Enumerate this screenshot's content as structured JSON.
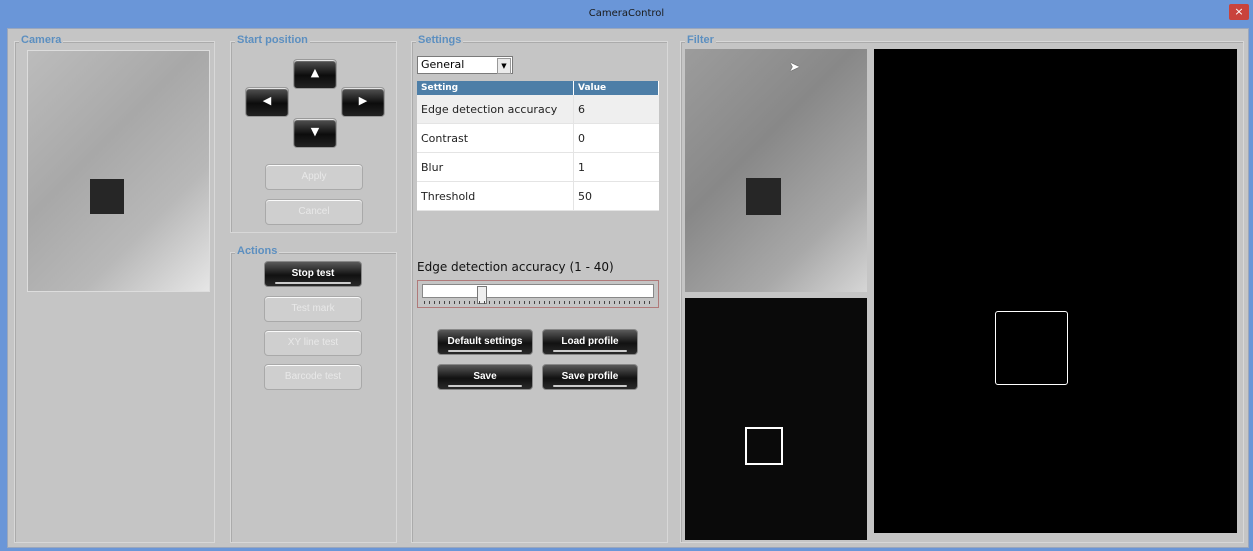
{
  "window": {
    "title": "CameraControl",
    "close_icon": "close-icon",
    "close_glyph": "×"
  },
  "groups": {
    "camera": "Camera",
    "start_position": "Start position",
    "actions": "Actions",
    "settings": "Settings",
    "filter": "Filter"
  },
  "start_position": {
    "arrows": [
      {
        "icon": "arrow-up-icon",
        "glyph": "▲"
      },
      {
        "icon": "arrow-left-icon",
        "glyph": "◀"
      },
      {
        "icon": "arrow-right-icon",
        "glyph": "▶"
      },
      {
        "icon": "arrow-down-icon",
        "glyph": "▼"
      }
    ],
    "apply_label": "Apply",
    "cancel_label": "Cancel"
  },
  "actions": {
    "stop_test": "Stop test",
    "test_mark": "Test mark",
    "xy_line_test": "XY line test",
    "barcode_test": "Barcode test"
  },
  "settings": {
    "category_selected": "General",
    "table": {
      "headers": [
        "Setting",
        "Value"
      ],
      "rows": [
        {
          "setting": "Edge detection accuracy",
          "value": "6"
        },
        {
          "setting": "Contrast",
          "value": "0"
        },
        {
          "setting": "Blur",
          "value": "1"
        },
        {
          "setting": "Threshold",
          "value": "50"
        }
      ]
    },
    "slider_label": "Edge detection accuracy (1 - 40)",
    "slider_value": 6,
    "slider_min": 1,
    "slider_max": 40,
    "buttons": {
      "default_settings": "Default settings",
      "load_profile": "Load profile",
      "save": "Save",
      "save_profile": "Save profile"
    }
  },
  "colors": {
    "titlebar": "#6a96d8",
    "group_label": "#5c8fc0",
    "table_header": "#4d7ea7",
    "close_button": "#c9433c"
  }
}
